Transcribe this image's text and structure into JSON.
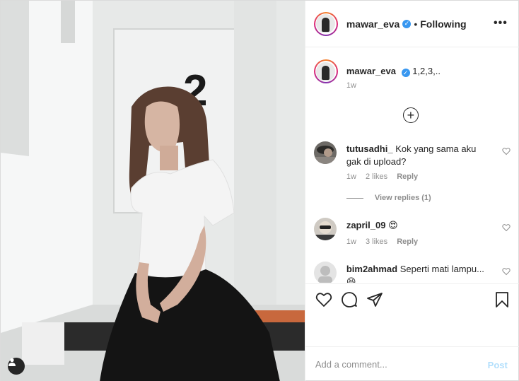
{
  "header": {
    "username": "mawar_eva",
    "verified_mark": "✓",
    "separator": "•",
    "follow_status": "Following",
    "more_label": "•••"
  },
  "caption": {
    "username": "mawar_eva",
    "text": "1,2,3,..",
    "time": "1w"
  },
  "photo": {
    "door_number": "2"
  },
  "comments": [
    {
      "username": "tutusadhi_",
      "text": "Kok yang sama aku gak di upload?",
      "time": "1w",
      "likes": "2 likes",
      "reply": "Reply"
    },
    {
      "username": "zapril_09",
      "text": "😍",
      "time": "1w",
      "likes": "3 likes",
      "reply": "Reply"
    },
    {
      "username": "bim2ahmad",
      "text": "Seperti mati lampu... 😆"
    }
  ],
  "view_replies": "View replies (1)",
  "add_comment": {
    "placeholder": "Add a comment...",
    "post_label": "Post"
  },
  "icons": [
    "like-icon",
    "comment-icon",
    "share-icon",
    "save-icon",
    "load-more-icon",
    "tag-user-icon",
    "more-options-icon"
  ],
  "colors": {
    "verified": "#3897f0",
    "post_disabled": "#b2dffc",
    "meta_text": "#8e8e8e"
  }
}
